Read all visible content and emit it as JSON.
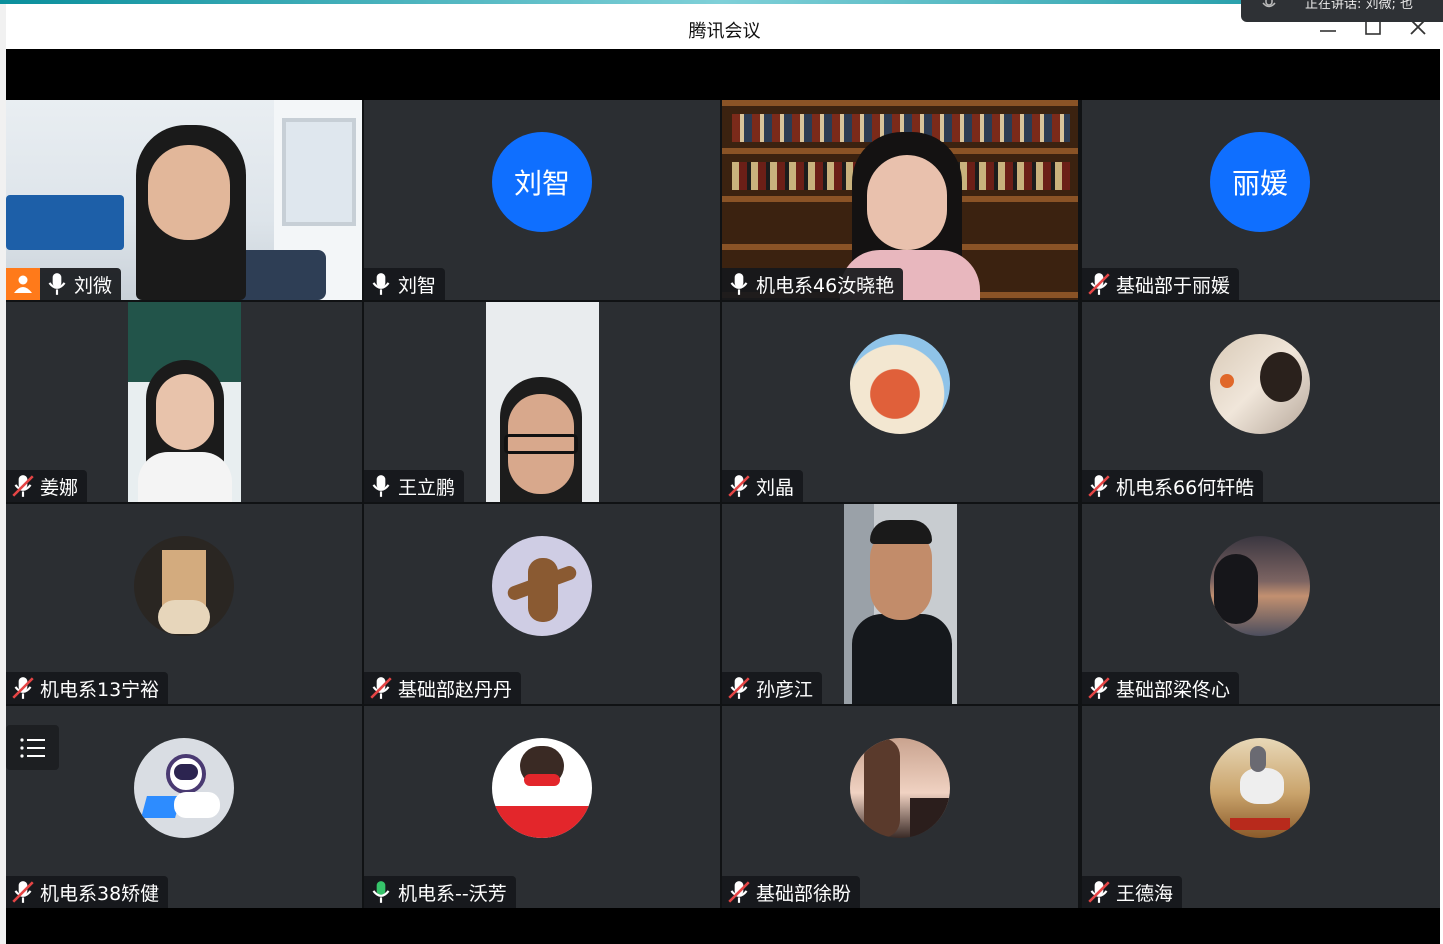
{
  "window": {
    "title": "腾讯会议",
    "toast_text": "正在讲话: 刘微; 也"
  },
  "colors": {
    "avatar_blue": "#0f6fff",
    "host_orange": "#ff7a1a",
    "speaking_green": "#36c46a",
    "muted_red": "#e54545"
  },
  "participants": [
    {
      "name": "刘微",
      "mic": "active",
      "host": true,
      "speaking": true,
      "kind": "video-room"
    },
    {
      "name": "刘智",
      "mic": "active",
      "kind": "text-avatar",
      "avatar_text": "刘智"
    },
    {
      "name": "机电系46汝晓艳",
      "mic": "active",
      "kind": "video-bookshelf"
    },
    {
      "name": "基础部于丽媛",
      "mic": "muted",
      "kind": "text-avatar",
      "avatar_text": "丽媛"
    },
    {
      "name": "姜娜",
      "mic": "muted",
      "kind": "video-portrait"
    },
    {
      "name": "王立鹏",
      "mic": "active",
      "kind": "video-portrait"
    },
    {
      "name": "刘晶",
      "mic": "muted",
      "kind": "image-avatar"
    },
    {
      "name": "机电系66何轩皓",
      "mic": "muted",
      "kind": "image-avatar"
    },
    {
      "name": "机电系13宁裕",
      "mic": "muted",
      "kind": "image-avatar"
    },
    {
      "name": "基础部赵丹丹",
      "mic": "muted",
      "kind": "image-avatar"
    },
    {
      "name": "孙彦江",
      "mic": "muted",
      "kind": "video-portrait"
    },
    {
      "name": "基础部梁佟心",
      "mic": "muted",
      "kind": "image-avatar"
    },
    {
      "name": "机电系38矫健",
      "mic": "muted",
      "kind": "image-avatar"
    },
    {
      "name": "机电系--沃芳",
      "mic": "speaking",
      "kind": "image-avatar"
    },
    {
      "name": "基础部徐盼",
      "mic": "muted",
      "kind": "image-avatar"
    },
    {
      "name": "王德海",
      "mic": "muted",
      "kind": "image-avatar"
    }
  ]
}
